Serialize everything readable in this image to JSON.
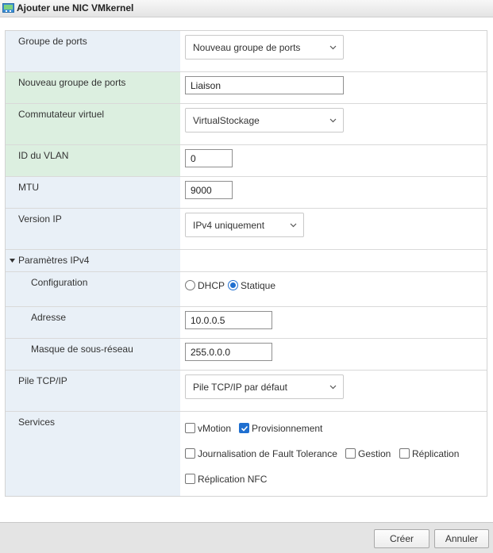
{
  "window": {
    "title": "Ajouter une NIC VMkernel",
    "icon": "network-adapter-icon"
  },
  "form": {
    "port_group": {
      "label": "Groupe de ports",
      "value": "Nouveau groupe de ports"
    },
    "new_port_group": {
      "label": "Nouveau groupe de ports",
      "value": "Liaison"
    },
    "virtual_switch": {
      "label": "Commutateur virtuel",
      "value": "VirtualStockage"
    },
    "vlan_id": {
      "label": "ID du VLAN",
      "value": "0"
    },
    "mtu": {
      "label": "MTU",
      "value": "9000"
    },
    "ip_version": {
      "label": "Version IP",
      "value": "IPv4 uniquement"
    },
    "ipv4_settings": {
      "label": "Paramètres IPv4",
      "expanded": true,
      "configuration": {
        "label": "Configuration",
        "options": [
          {
            "label": "DHCP",
            "selected": false
          },
          {
            "label": "Statique",
            "selected": true
          }
        ]
      },
      "address": {
        "label": "Adresse",
        "value": "10.0.0.5"
      },
      "subnet_mask": {
        "label": "Masque de sous-réseau",
        "value": "255.0.0.0"
      }
    },
    "tcpip_stack": {
      "label": "Pile TCP/IP",
      "value": "Pile TCP/IP par défaut"
    },
    "services": {
      "label": "Services",
      "items": [
        {
          "label": "vMotion",
          "checked": false
        },
        {
          "label": "Provisionnement",
          "checked": true
        },
        {
          "label": "Journalisation de Fault Tolerance",
          "checked": false
        },
        {
          "label": "Gestion",
          "checked": false
        },
        {
          "label": "Réplication",
          "checked": false
        },
        {
          "label": "Réplication NFC",
          "checked": false
        }
      ]
    }
  },
  "footer": {
    "create_label": "Créer",
    "cancel_label": "Annuler"
  },
  "colors": {
    "label_blue": "#e9f0f7",
    "label_green": "#dcefe0",
    "accent": "#1f6fd0"
  }
}
